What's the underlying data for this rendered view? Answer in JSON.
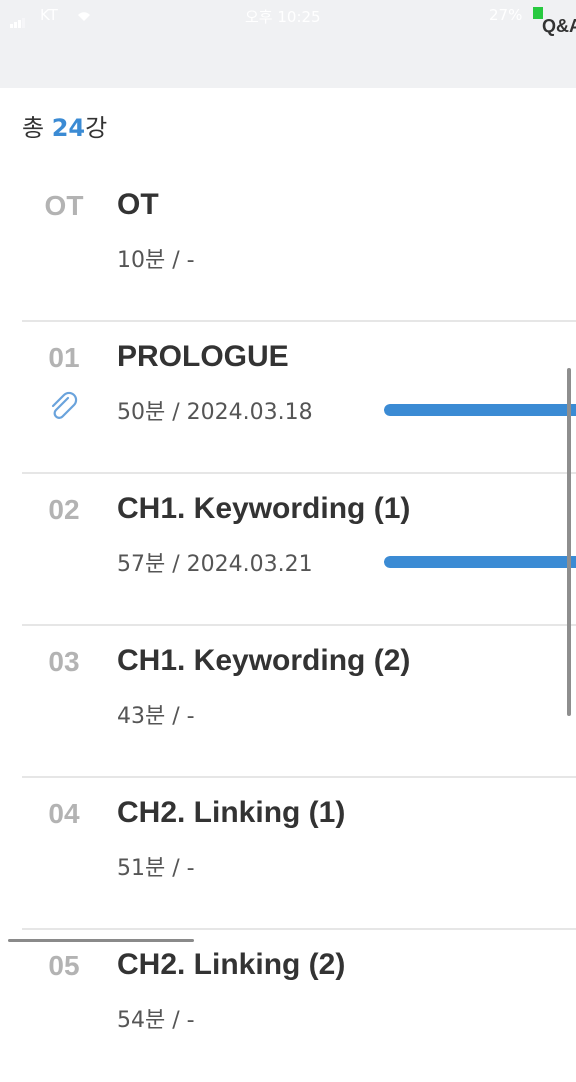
{
  "status_bar": {
    "carrier": "KT",
    "time": "오후 10:25",
    "battery": "27%"
  },
  "header": {
    "qa_label": "Q&A"
  },
  "summary": {
    "prefix": "총",
    "count": "24",
    "suffix": "강"
  },
  "lessons": [
    {
      "number": "OT",
      "title": "OT",
      "meta": "10분 / -",
      "progress": null
    },
    {
      "number": "01",
      "title": "PROLOGUE",
      "meta": "50분 / 2024.03.18",
      "progress": 1.0
    },
    {
      "number": "02",
      "title": "CH1. Keywording (1)",
      "meta": "57분 / 2024.03.21",
      "progress": 1.0
    },
    {
      "number": "03",
      "title": "CH1. Keywording (2)",
      "meta": "43분 / -",
      "progress": null
    },
    {
      "number": "04",
      "title": "CH2. Linking (1)",
      "meta": "51분 / -",
      "progress": null
    },
    {
      "number": "05",
      "title": "CH2. Linking (2)",
      "meta": "54분 / -",
      "progress": null
    }
  ],
  "icons": {
    "attachment": "paperclip-icon"
  },
  "colors": {
    "accent": "#3b8bd4",
    "number": "#b3b3b3"
  }
}
